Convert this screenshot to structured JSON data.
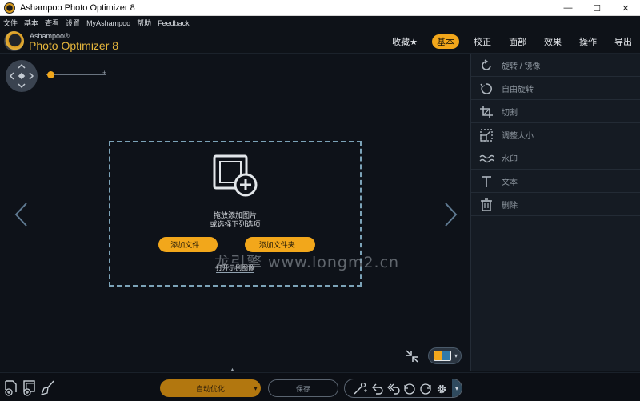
{
  "window": {
    "title": "Ashampoo Photo Optimizer 8",
    "minimize": "—",
    "maximize": "☐",
    "close": "✕"
  },
  "menu": [
    "文件",
    "基本",
    "查看",
    "设置",
    "MyAshampoo",
    "帮助",
    "Feedback"
  ],
  "brand": {
    "small": "Ashampoo®",
    "big": "Photo Optimizer 8"
  },
  "nav": {
    "tabs": [
      "收藏★",
      "基本",
      "校正",
      "面部",
      "效果",
      "操作",
      "导出"
    ],
    "active": "基本"
  },
  "dropzone": {
    "line1": "拖放添加图片",
    "line2": "或选择下列选项",
    "add_files": "添加文件...",
    "add_folder": "添加文件夹...",
    "open_sample": "打开示例图像"
  },
  "zoom": {
    "plus": "+",
    "level": 0.08
  },
  "watermark": "龙引擎 www.longm2.cn",
  "panel": {
    "items": [
      "旋转 / 镜像",
      "自由旋转",
      "切割",
      "调整大小",
      "水印",
      "文本",
      "删除"
    ]
  },
  "bottom": {
    "auto_optimize": "自动优化",
    "save": "保存",
    "dropdown_arrow": "▾",
    "expand": "▲"
  },
  "colors": {
    "accent": "#f2a71b",
    "background": "#0e1219",
    "panel": "#151b23"
  }
}
